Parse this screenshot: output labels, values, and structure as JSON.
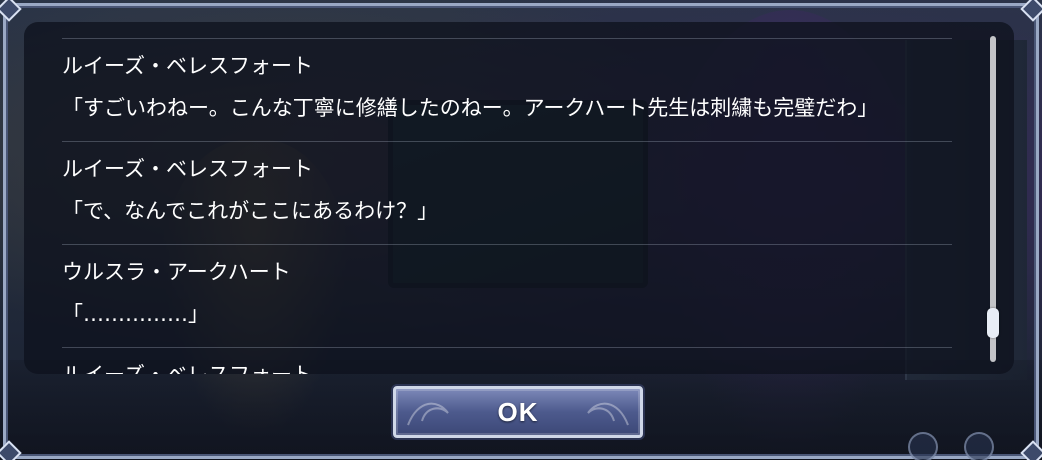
{
  "log": {
    "entries": [
      {
        "speaker": "ルイーズ・ベレスフォート",
        "text": "「すごいわねー。こんな丁寧に修繕したのねー。アークハート先生は刺繍も完璧だわ」"
      },
      {
        "speaker": "ルイーズ・ベレスフォート",
        "text": "「で、なんでこれがここにあるわけ？」"
      },
      {
        "speaker": "ウルスラ・アークハート",
        "text": "「……………」"
      },
      {
        "speaker": "ルイーズ・ベレスフォート",
        "text": ""
      }
    ]
  },
  "scrollbar": {
    "position": 0.92
  },
  "ok_button": {
    "label": "OK"
  },
  "colors": {
    "panel": "#0e121e",
    "frame": "#9aa8c4",
    "button": "#4d5a8d",
    "text": "#ffffff"
  },
  "icons": {
    "corner": "corner-ornament-icon",
    "nav_prev": "nav-prev-icon",
    "nav_next": "nav-next-icon"
  }
}
